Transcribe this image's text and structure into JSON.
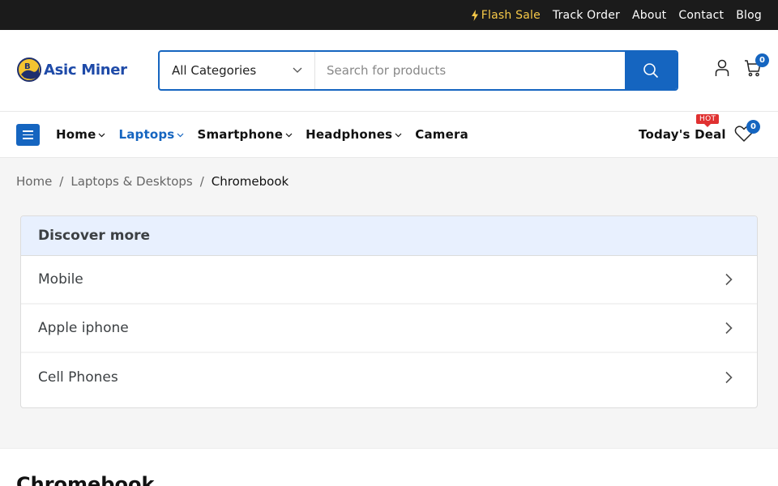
{
  "topbar": {
    "links": [
      {
        "label": "Flash Sale",
        "icon": "bolt-icon",
        "color": "#f7c948"
      },
      {
        "label": "Track Order"
      },
      {
        "label": "About"
      },
      {
        "label": "Contact"
      },
      {
        "label": "Blog"
      }
    ]
  },
  "header": {
    "logo_text": "Asic Miner",
    "category_select": "All Categories",
    "search_placeholder": "Search for products",
    "cart_count": "0",
    "icons": [
      "user-icon",
      "cart-icon",
      "search-icon"
    ]
  },
  "nav": {
    "items": [
      {
        "label": "Home",
        "has_dropdown": true,
        "active": false
      },
      {
        "label": "Laptops",
        "has_dropdown": true,
        "active": true
      },
      {
        "label": "Smartphone",
        "has_dropdown": true,
        "active": false
      },
      {
        "label": "Headphones",
        "has_dropdown": true,
        "active": false
      },
      {
        "label": "Camera",
        "has_dropdown": false,
        "active": false
      }
    ],
    "deal_label": "Today's Deal",
    "hot_badge": "HOT",
    "wishlist_count": "0"
  },
  "breadcrumb": {
    "items": [
      "Home",
      "Laptops & Desktops",
      "Chromebook"
    ]
  },
  "discover": {
    "title": "Discover more",
    "items": [
      "Mobile",
      "Apple iphone",
      "Cell Phones"
    ]
  },
  "page_title": "Chromebook",
  "colors": {
    "primary": "#1565c0",
    "topbar_bg": "#1b1b1b",
    "hot": "#e03131",
    "discover_head": "#e8f0fe"
  }
}
